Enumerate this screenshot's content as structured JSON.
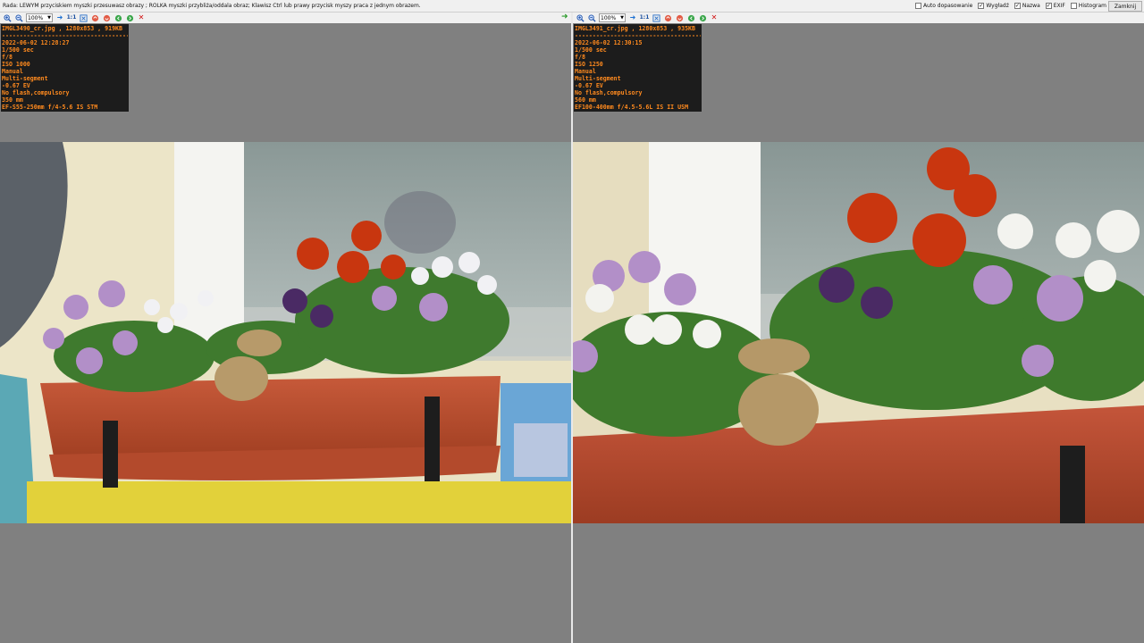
{
  "hint": "Rada: LEWYM przyciskiem myszki przesuwasz obrazy ; ROLKA myszki przybliża/oddala obraz; Klawisz Ctrl lub prawy przycisk myszy praca z jednym obrazem.",
  "options": [
    {
      "label": "Auto dopasowanie",
      "checked": false
    },
    {
      "label": "Wygładź",
      "checked": true
    },
    {
      "label": "Nazwa",
      "checked": true
    },
    {
      "label": "EXIF",
      "checked": true
    },
    {
      "label": "Histogram",
      "checked": false
    }
  ],
  "close_label": "Zamknij",
  "panes": [
    {
      "zoom": "100%",
      "one_to_one": "1:1",
      "exif": [
        "IMGL3490_cr.jpg , 1280x853 , 919KB",
        "------------------------------------",
        "2022-06-02 12:28:27",
        "1/500 sec",
        "f/8",
        "ISO 1000",
        "Manual",
        "Multi-segment",
        "-0.67 EV",
        "No flash,compulsory",
        "350 mm",
        "EF-S55-250mm f/4-5.6 IS STM"
      ]
    },
    {
      "zoom": "100%",
      "one_to_one": "1:1",
      "exif": [
        "IMGL3491_cr.jpg , 1280x853 , 935KB",
        "------------------------------------",
        "2022-06-02 12:30:15",
        "1/500 sec",
        "f/8",
        "ISO 1250",
        "Manual",
        "Multi-segment",
        "-0.67 EV",
        "No flash,compulsory",
        "560 mm",
        "EF100-400mm f/4.5-5.6L IS II USM"
      ]
    }
  ],
  "colors": {
    "exif_text": "#ff8a1e",
    "exif_bg": "#1c1c1c",
    "pane_bg": "#808080",
    "planter": "#b5472a"
  }
}
